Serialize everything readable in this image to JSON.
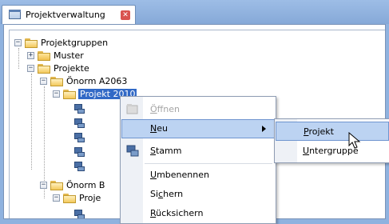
{
  "tab": {
    "title": "Projektverwaltung",
    "close_icon": "close-icon"
  },
  "tree": {
    "root": "Projektgruppen",
    "muster": "Muster",
    "projekte": "Projekte",
    "onorm_a": "Önorm A2063",
    "selected_item": "Projekt 2010",
    "onorm_b": "Önorm B",
    "proje": "Proje"
  },
  "menu": {
    "oeffnen": {
      "pre": "",
      "key": "Ö",
      "post": "ffnen"
    },
    "neu": {
      "pre": "",
      "key": "N",
      "post": "eu"
    },
    "stamm": {
      "pre": "",
      "key": "S",
      "post": "tamm"
    },
    "umbenennen": {
      "pre": "",
      "key": "U",
      "post": "mbenennen"
    },
    "sichern": {
      "pre": "Si",
      "key": "c",
      "post": "hern"
    },
    "ruecksichern": {
      "pre": "",
      "key": "R",
      "post": "ücksichern"
    }
  },
  "submenu": {
    "projekt": {
      "pre": "",
      "key": "P",
      "post": "rojekt"
    },
    "untergruppe": {
      "pre": "",
      "key": "U",
      "post": "ntergruppe"
    }
  },
  "colors": {
    "background": "#8fb2df",
    "selection": "#3169c6",
    "menu_highlight": "#bcd3f2"
  }
}
